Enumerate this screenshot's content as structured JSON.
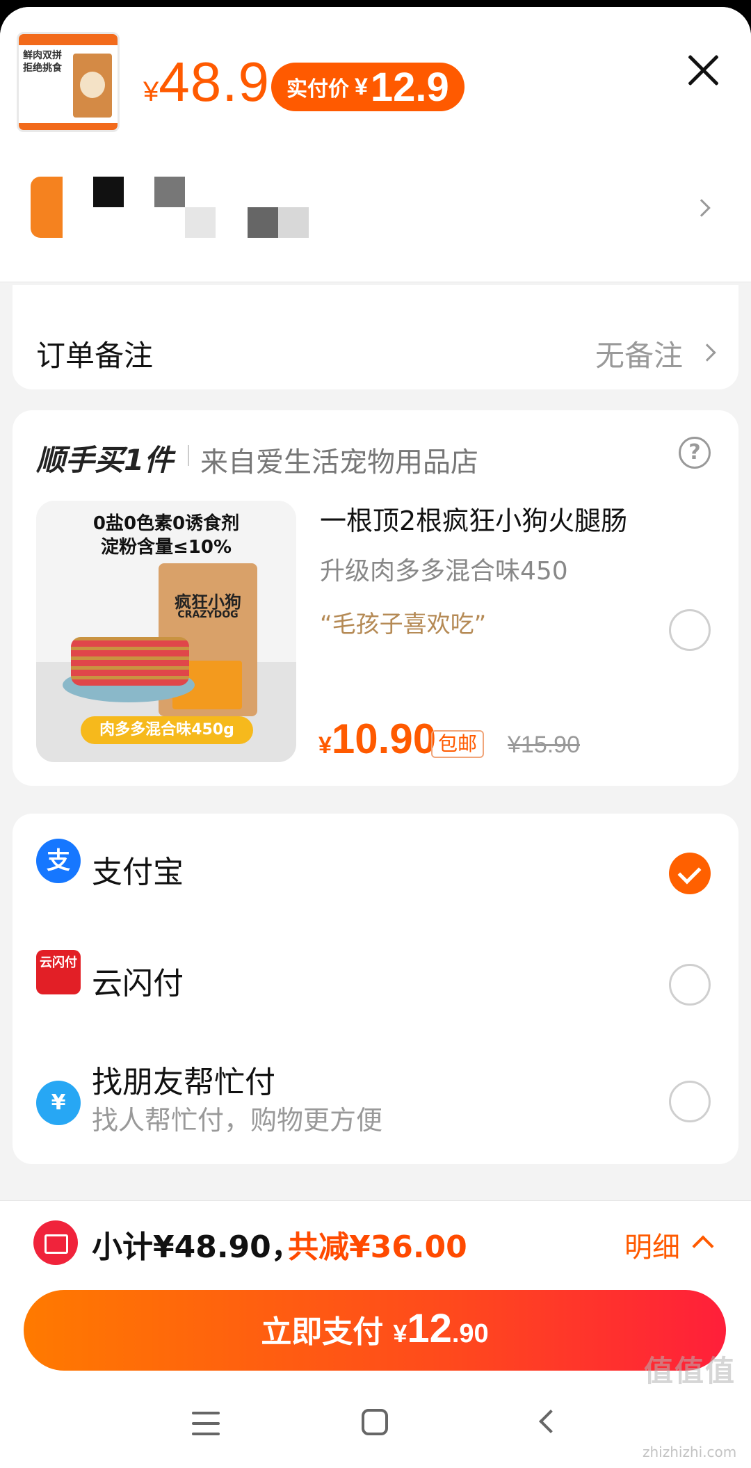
{
  "header": {
    "thumb_text": "鲜肉双拼\n拒绝挑食",
    "price_currency": "¥",
    "price": "48.9",
    "pay_label": "实付价",
    "pay_currency": "¥",
    "pay_price": "12.9"
  },
  "order_note": {
    "label": "订单备注",
    "value": "无备注"
  },
  "add_on": {
    "title": "顺手买1件",
    "shop": "来自爱生活宠物用品店",
    "help_icon": "?",
    "image_text_line1": "0盐0色素0诱食剂",
    "image_text_line2": "淀粉含量≤10%",
    "image_brand": "疯狂小狗",
    "image_brand_en": "CRAZYDOG",
    "image_tag": "肉多多混合味450g",
    "name": "一根顶2根疯狂小狗火腿肠",
    "spec": "升级肉多多混合味450",
    "quote": "“毛孩子喜欢吃”",
    "price_currency": "¥",
    "price": "10.90",
    "shipping": "包邮",
    "original_price": "¥15.90",
    "selected": false
  },
  "payment": {
    "methods": [
      {
        "name": "支付宝",
        "sub": "",
        "icon": "alipay-icon",
        "selected": true
      },
      {
        "name": "云闪付",
        "sub": "",
        "icon": "unionpay-icon",
        "selected": false
      },
      {
        "name": "找朋友帮忙付",
        "sub": "找人帮忙付，购物更方便",
        "icon": "friend-pay-icon",
        "selected": false
      }
    ]
  },
  "summary": {
    "subtotal": "小计¥48.90，",
    "saved": "共减¥36.00",
    "detail": "明细"
  },
  "pay_button": {
    "label": "立即支付",
    "currency": "¥",
    "int": "12",
    "dec": ".90"
  },
  "colors": {
    "accent": "#ff5a00",
    "alipay": "#1677ff",
    "unionpay": "#e21f26"
  },
  "watermark": {
    "text": "值值值",
    "sub": "zhizhizhi.com"
  }
}
